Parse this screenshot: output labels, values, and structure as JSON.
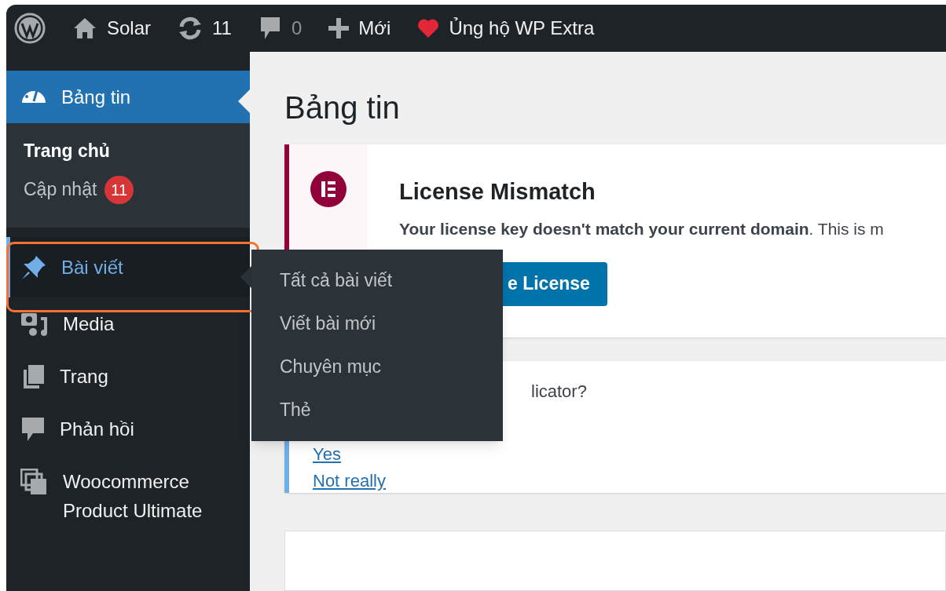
{
  "admin_bar": {
    "items": [
      {
        "kind": "logo"
      },
      {
        "kind": "site",
        "label": "Solar"
      },
      {
        "kind": "updates",
        "label": "11"
      },
      {
        "kind": "comments",
        "label": "0"
      },
      {
        "kind": "new",
        "label": "Mới"
      },
      {
        "kind": "support",
        "label": "Ủng hộ WP Extra"
      }
    ]
  },
  "sidebar": {
    "items": [
      {
        "kind": "dashboard",
        "label": "Bảng tin",
        "selected": true,
        "highlighted": false,
        "children": [
          {
            "label": "Trang chủ",
            "selected": true
          },
          {
            "label": "Cập nhật",
            "badge": "11",
            "selected": false
          }
        ]
      },
      {
        "kind": "posts",
        "label": "Bài viết",
        "selected": false,
        "highlighted": true,
        "flyout": [
          "Tất cả bài viết",
          "Viết bài mới",
          "Chuyên mục",
          "Thẻ"
        ]
      },
      {
        "kind": "media",
        "label": "Media",
        "selected": false,
        "highlighted": false
      },
      {
        "kind": "pages",
        "label": "Trang",
        "selected": false,
        "highlighted": false
      },
      {
        "kind": "comments",
        "label": "Phản hồi",
        "selected": false,
        "highlighted": false
      },
      {
        "kind": "plugin",
        "label": "Woocommerce Product Ultimate",
        "selected": false,
        "highlighted": false
      }
    ]
  },
  "page": {
    "title": "Bảng tin",
    "notices": [
      {
        "kind": "license",
        "title": "License Mismatch",
        "message": "**Your license key doesn't match your current domain**. This is m",
        "button": "e License"
      },
      {
        "kind": "feedback",
        "question": "licator?",
        "links": [
          "Yes",
          "Not really"
        ]
      }
    ]
  }
}
